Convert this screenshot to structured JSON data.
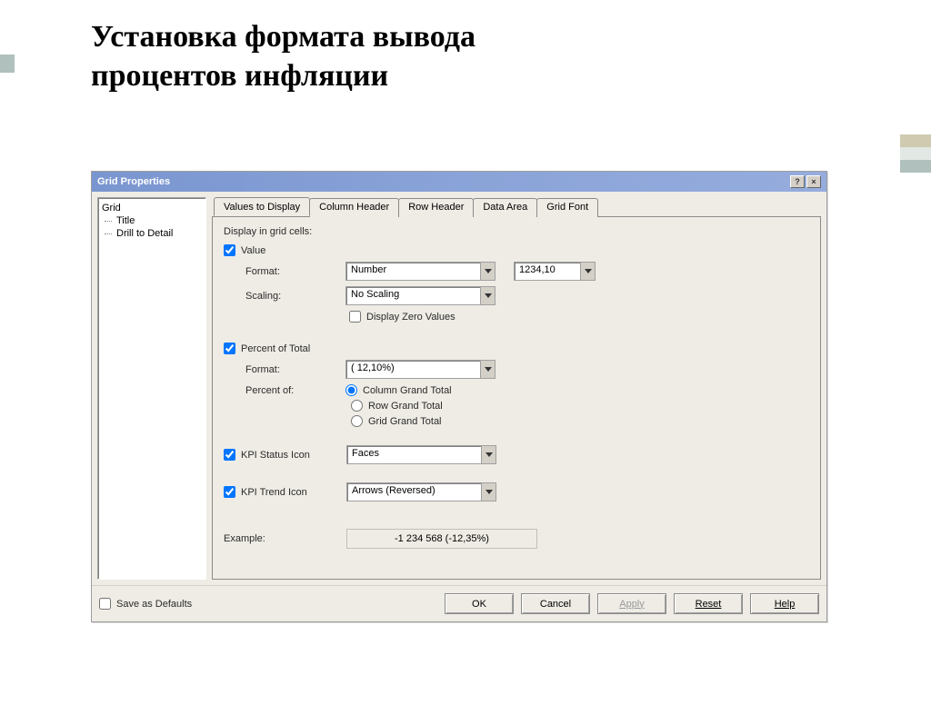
{
  "slide": {
    "heading_line1": "Установка формата вывода",
    "heading_line2": "процентов инфляции"
  },
  "dialog": {
    "title": "Grid Properties",
    "help_btn": "?",
    "close_btn": "×"
  },
  "tree": {
    "items": [
      "Grid",
      "Title",
      "Drill to Detail"
    ]
  },
  "tabs": {
    "items": [
      "Values to Display",
      "Column Header",
      "Row Header",
      "Data Area",
      "Grid Font"
    ]
  },
  "content": {
    "display_in_cells": "Display in grid cells:",
    "value_check": "Value",
    "format_label": "Format:",
    "format_value": "Number",
    "format_sample": "1234,10",
    "scaling_label": "Scaling:",
    "scaling_value": "No Scaling",
    "display_zero": "Display Zero Values",
    "percent_total_check": "Percent of Total",
    "percent_format_label": "Format:",
    "percent_format_value": "( 12,10%)",
    "percent_of_label": "Percent of:",
    "radio_col": "Column Grand Total",
    "radio_row": "Row Grand Total",
    "radio_grid": "Grid Grand Total",
    "kpi_status_check": "KPI Status Icon",
    "kpi_status_value": "Faces",
    "kpi_trend_check": "KPI Trend Icon",
    "kpi_trend_value": "Arrows (Reversed)",
    "example_label": "Example:",
    "example_value": "-1 234 568  (-12,35%)"
  },
  "footer": {
    "save_defaults": "Save as Defaults",
    "ok": "OK",
    "cancel": "Cancel",
    "apply": "Apply",
    "reset": "Reset",
    "help": "Help"
  }
}
